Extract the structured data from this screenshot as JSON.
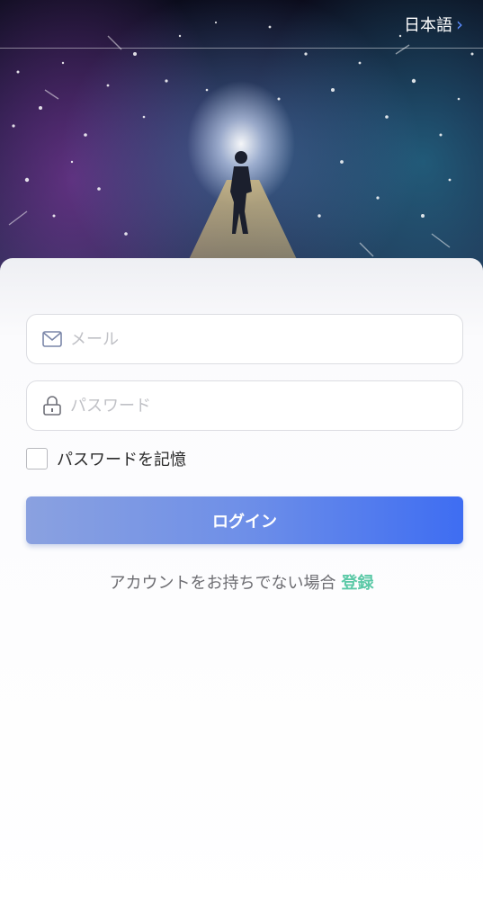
{
  "header": {
    "language_label": "日本語",
    "language_chevron": "›"
  },
  "login": {
    "email_placeholder": "メール",
    "password_placeholder": "パスワード",
    "remember_label": "パスワードを記憶",
    "login_button_label": "ログイン",
    "no_account_text": "アカウントをお持ちでない場合",
    "register_link_label": "登録"
  },
  "icons": {
    "email": "mail-icon",
    "password": "lock-icon",
    "language": "chevron-right-icon"
  },
  "colors": {
    "accent": "#3e6df2",
    "accent_light": "#8aa1e0",
    "link_green": "#5cc9a7",
    "chevron_blue": "#5b8cff"
  }
}
